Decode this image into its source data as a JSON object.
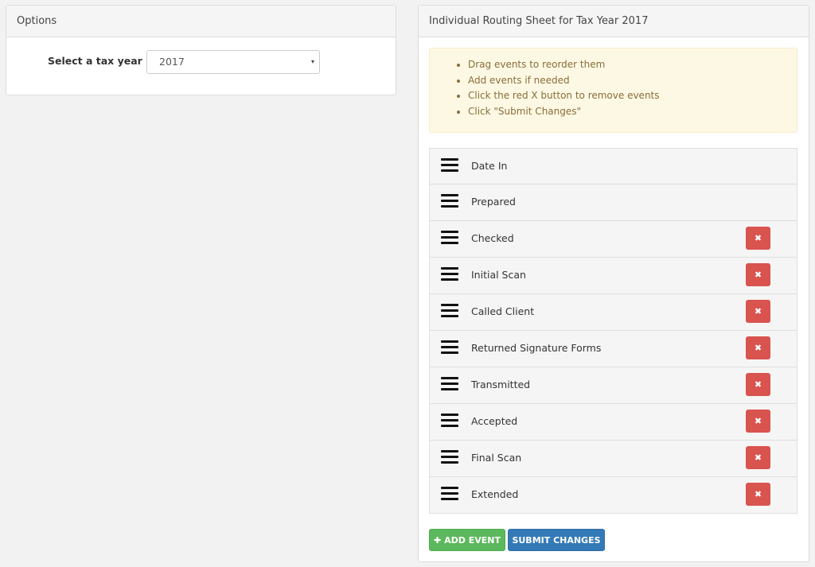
{
  "options": {
    "title": "Options",
    "tax_year_label": "Select a tax year",
    "tax_year_value": "2017",
    "caret_icon": "▾"
  },
  "routing": {
    "title": "Individual Routing Sheet for Tax Year 2017",
    "instructions": [
      "Drag events to reorder them",
      "Add events if needed",
      "Click the red X button to remove events",
      "Click \"Submit Changes\""
    ],
    "events": [
      {
        "label": "Date In",
        "removable": false
      },
      {
        "label": "Prepared",
        "removable": false
      },
      {
        "label": "Checked",
        "removable": true
      },
      {
        "label": "Initial Scan",
        "removable": true
      },
      {
        "label": "Called Client",
        "removable": true
      },
      {
        "label": "Returned Signature Forms",
        "removable": true
      },
      {
        "label": "Transmitted",
        "removable": true
      },
      {
        "label": "Accepted",
        "removable": true
      },
      {
        "label": "Final Scan",
        "removable": true
      },
      {
        "label": "Extended",
        "removable": true
      }
    ],
    "remove_glyph": "✖",
    "add_event_label": "✚ ADD EVENT",
    "submit_label": "SUBMIT CHANGES"
  },
  "colors": {
    "danger": "#d9534f",
    "success": "#5cb85c",
    "primary": "#337ab7",
    "warning_bg": "#fcf8e3"
  }
}
